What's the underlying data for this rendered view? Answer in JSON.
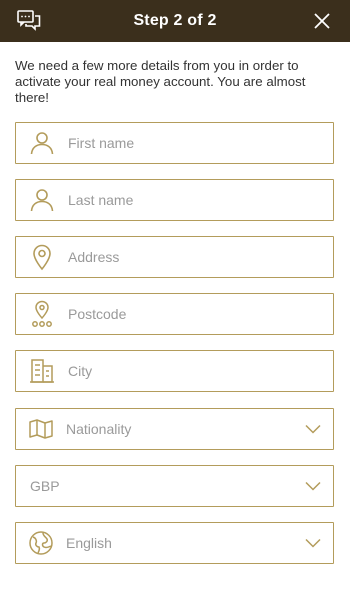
{
  "header": {
    "title": "Step 2 of 2",
    "chat_icon": "chat-icon",
    "close_icon": "close-icon"
  },
  "intro": {
    "text": "We need a few more details from you in order to activate your real money account. You are almost there!"
  },
  "fields": {
    "first_name": {
      "placeholder": "First name",
      "icon": "person-icon"
    },
    "last_name": {
      "placeholder": "Last name",
      "icon": "person-icon"
    },
    "address": {
      "placeholder": "Address",
      "icon": "map-pin-icon"
    },
    "postcode": {
      "placeholder": "Postcode",
      "icon": "postcode-pin-icon"
    },
    "city": {
      "placeholder": "City",
      "icon": "building-icon"
    }
  },
  "selects": {
    "nationality": {
      "value": "Nationality",
      "icon": "map-icon"
    },
    "currency": {
      "value": "GBP"
    },
    "language": {
      "value": "English",
      "icon": "globe-icon"
    }
  },
  "colors": {
    "header_bg": "#3b2f1c",
    "accent": "#b39c5b",
    "placeholder": "#9a9a9a"
  }
}
